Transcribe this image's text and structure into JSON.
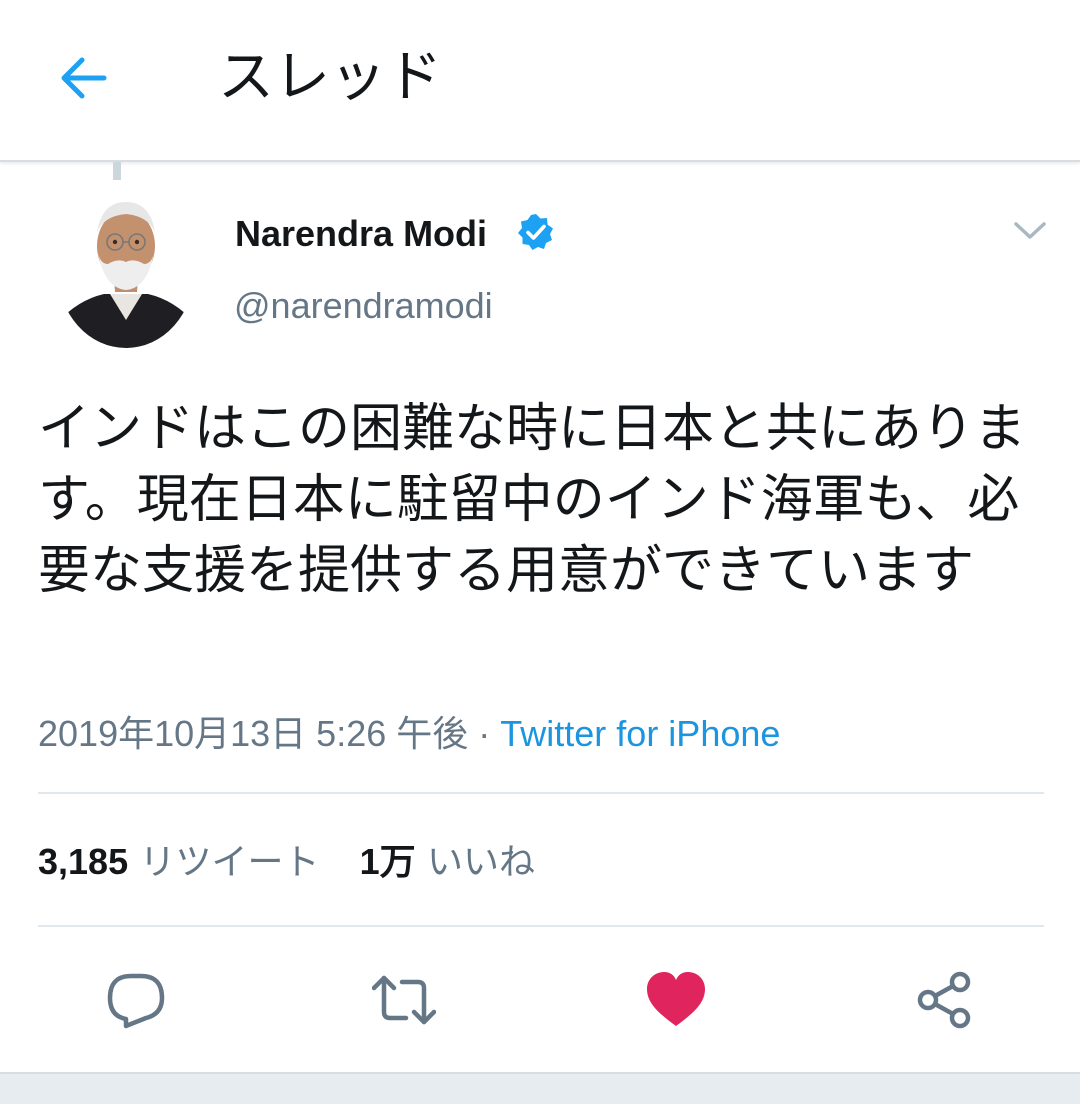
{
  "colors": {
    "accent": "#1da1f2",
    "text_primary": "#14171a",
    "text_secondary": "#657786",
    "link": "#1b95e0",
    "like": "#e0245e",
    "divider": "#e1e8ed"
  },
  "header": {
    "back_icon": "arrow-left-icon",
    "title": "スレッド"
  },
  "tweet": {
    "author": {
      "name": "Narendra Modi",
      "handle": "@narendramodi",
      "verified": true
    },
    "text": "インドはこの困難な時に日本と共にあります。現在日本に駐留中のインド海軍も、必要な支援を提供する用意ができています",
    "timestamp": "2019年10月13日 5:26 午後",
    "separator": "·",
    "source": "Twitter for iPhone"
  },
  "stats": {
    "retweets_count": "3,185",
    "retweets_label": "リツイート",
    "likes_count": "1万",
    "likes_label": "いいね"
  },
  "actions": {
    "reply_icon": "reply-icon",
    "retweet_icon": "retweet-icon",
    "like_icon": "heart-icon",
    "liked": true,
    "share_icon": "share-icon"
  }
}
